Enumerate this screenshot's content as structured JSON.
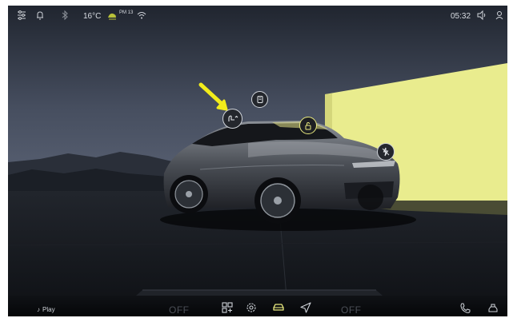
{
  "status_bar": {
    "temperature": "16°C",
    "aqi": "PM 13",
    "time": "05:32",
    "icons": [
      "settings-sliders-icon",
      "bell-icon",
      "bluetooth-icon",
      "air-quality-icon",
      "wifi-icon",
      "volume-icon",
      "user-icon"
    ]
  },
  "hotspots": {
    "seat": "seat-adjust-icon",
    "rear_window": "rear-window-icon",
    "lock": "lock-icon",
    "charge": "charging-port-icon"
  },
  "dock": {
    "left_status": "OFF",
    "right_status": "OFF",
    "media_label": "Play",
    "items": [
      "apps-grid-icon",
      "settings-gear-icon",
      "vehicle-icon",
      "navigation-icon"
    ],
    "right_icons": [
      "phone-icon",
      "car-seat-icon"
    ]
  },
  "colors": {
    "accent": "#e9ea7f",
    "wall": "#e9ec8e",
    "background": "#1a1e26",
    "arrow": "#f2ec1b"
  }
}
